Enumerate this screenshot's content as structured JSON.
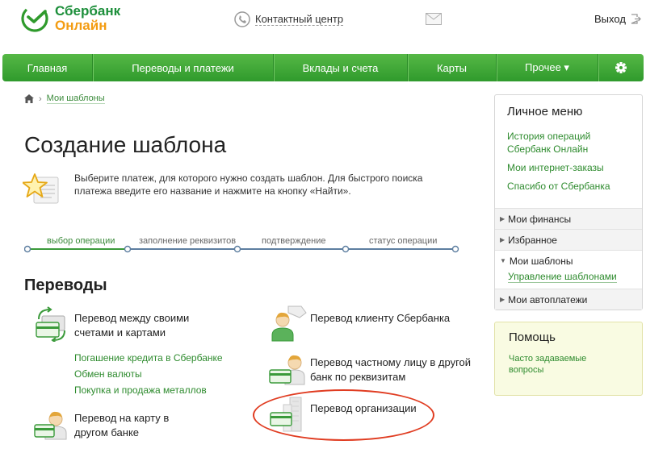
{
  "header": {
    "logo_line1": "Сбербанк",
    "logo_line2": "Онлайн",
    "contact": "Контактный центр",
    "logout": "Выход"
  },
  "nav": {
    "items": [
      {
        "label": "Главная"
      },
      {
        "label": "Переводы и платежи"
      },
      {
        "label": "Вклады и счета"
      },
      {
        "label": "Карты"
      },
      {
        "label": "Прочее ▾"
      }
    ]
  },
  "breadcrumb": {
    "link": "Мои шаблоны"
  },
  "page": {
    "title": "Создание шаблона",
    "intro": "Выберите платеж, для которого нужно создать шаблон. Для быстрого поиска платежа введите его название и нажмите на кнопку «Найти»."
  },
  "steps": [
    {
      "label": "выбор операции"
    },
    {
      "label": "заполнение реквизитов"
    },
    {
      "label": "подтверждение"
    },
    {
      "label": "статус операции"
    }
  ],
  "transfers": {
    "title": "Переводы",
    "own": "Перевод между своими счетами и картами",
    "sublinks": [
      "Погашение кредита в Сбербанке",
      "Обмен валюты",
      "Покупка и продажа металлов"
    ],
    "card_other_bank": "Перевод на карту в другом банке",
    "client": "Перевод клиенту Сбербанка",
    "private_other_bank": "Перевод частному лицу в другой банк по реквизитам",
    "organization": "Перевод организации"
  },
  "sidebar": {
    "title": "Личное меню",
    "links": [
      "История операций Сбербанк Онлайн",
      "Мои интернет-заказы",
      "Спасибо от Сбербанка"
    ],
    "sections": [
      {
        "label": "Мои финансы"
      },
      {
        "label": "Избранное"
      },
      {
        "label": "Мои шаблоны"
      },
      {
        "label": "Мои автоплатежи"
      }
    ],
    "templates_sub": "Управление шаблонами"
  },
  "help": {
    "title": "Помощь",
    "link": "Часто задаваемые вопросы"
  },
  "colors": {
    "brand_green": "#2f9a2c",
    "link_green": "#2e8b2e",
    "accent_orange": "#f39c12",
    "highlight_red": "#e03c21"
  }
}
